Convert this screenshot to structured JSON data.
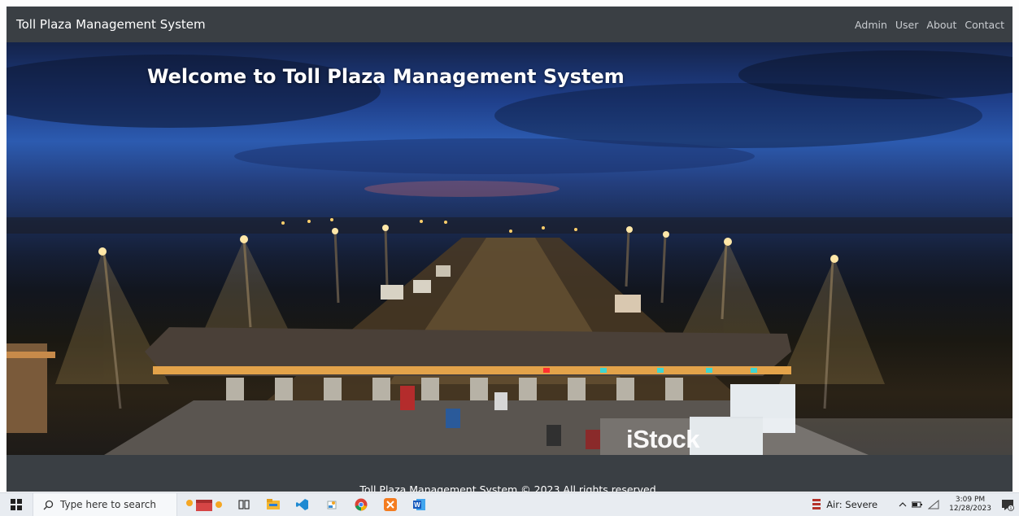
{
  "navbar": {
    "brand": "Toll Plaza Management System",
    "links": [
      "Admin",
      "User",
      "About",
      "Contact"
    ]
  },
  "hero": {
    "title": "Welcome to Toll Plaza Management System",
    "watermark": "iStock"
  },
  "footer": {
    "text": "Toll Plaza Management System © 2023 All rights reserved."
  },
  "taskbar": {
    "search_placeholder": "Type here to search",
    "weather": "Air: Severe",
    "time": "3:09 PM",
    "date": "12/28/2023"
  },
  "colors": {
    "navbar_bg": "#3a3f44",
    "nav_text": "#c9ccd0",
    "taskbar_bg": "#e8ecf1"
  }
}
